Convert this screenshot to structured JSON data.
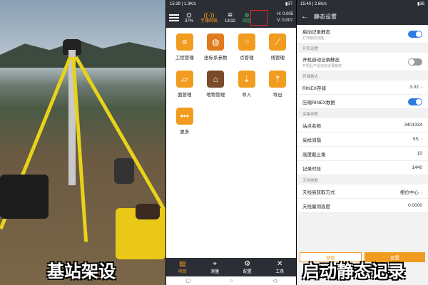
{
  "panels": {
    "left_caption": "基站架设",
    "right_caption": "启动静态记录"
  },
  "phone1": {
    "status_bar": {
      "time": "15:39",
      "speed": "1.3K/s",
      "battery": "37"
    },
    "stats": [
      {
        "icon": "satellite",
        "value": "37%"
      },
      {
        "icon": "signal",
        "value": "手簿网络",
        "highlight": true
      },
      {
        "icon": "satellite-count",
        "value": "13/32"
      },
      {
        "icon": "gps",
        "value": "固定"
      }
    ],
    "precision": {
      "h": "H: 0.005",
      "v": "V: 0.007"
    },
    "grid": [
      {
        "label": "工程管理",
        "icon": "≡",
        "color": "#f29c1f"
      },
      {
        "label": "坐标系参数",
        "icon": "◍",
        "color": "#e07a1c"
      },
      {
        "label": "点管理",
        "icon": "⁘",
        "color": "#f29c1f"
      },
      {
        "label": "线管理",
        "icon": "⟋",
        "color": "#f29c1f"
      },
      {
        "label": "面管理",
        "icon": "▱",
        "color": "#f29c1f"
      },
      {
        "label": "地物管理",
        "icon": "⌂",
        "color": "#7a4a2a"
      },
      {
        "label": "导入",
        "icon": "⇣",
        "color": "#f29c1f"
      },
      {
        "label": "导出",
        "icon": "⇡",
        "color": "#f29c1f"
      },
      {
        "label": "更多",
        "icon": "•••",
        "color": "#f29c1f"
      }
    ],
    "nav": [
      {
        "label": "项目",
        "icon": "▤",
        "active": true
      },
      {
        "label": "测量",
        "icon": "⌖",
        "active": false
      },
      {
        "label": "配置",
        "icon": "⚙",
        "active": false
      },
      {
        "label": "工具",
        "icon": "✕",
        "active": false
      }
    ]
  },
  "phone2": {
    "status_bar": {
      "time": "15:40",
      "speed": "2.6K/s",
      "battery": "36"
    },
    "title": "静态设置",
    "rows": {
      "auto_start": {
        "label": "启动记录静态",
        "sub": "打开静态功能",
        "on": true
      },
      "sec_boot": "开机设置",
      "boot_record": {
        "label": "开机自动记录静态",
        "sub": "开机后不是自动记录静态",
        "on": false
      },
      "sec_store": "存储格式",
      "rinex": {
        "label": "RINEX存储",
        "value": "3.02"
      },
      "compress": {
        "label": "压缩RINEX数据",
        "on": true
      },
      "sec_collect": "采集参数",
      "site": {
        "label": "站点名称",
        "value": "3401334"
      },
      "interval": {
        "label": "采样间隔",
        "value": "5S"
      },
      "elev": {
        "label": "高度截止角",
        "value": "10"
      },
      "duration": {
        "label": "记录时段",
        "value": "1440"
      },
      "sec_antenna": "天线参数",
      "ant_method": {
        "label": "天线高获取方式",
        "value": "相位中心"
      },
      "ant_height": {
        "label": "天线量测高度",
        "value": "0.0000"
      }
    },
    "buttons": {
      "get": "获取",
      "set": "设置"
    }
  }
}
